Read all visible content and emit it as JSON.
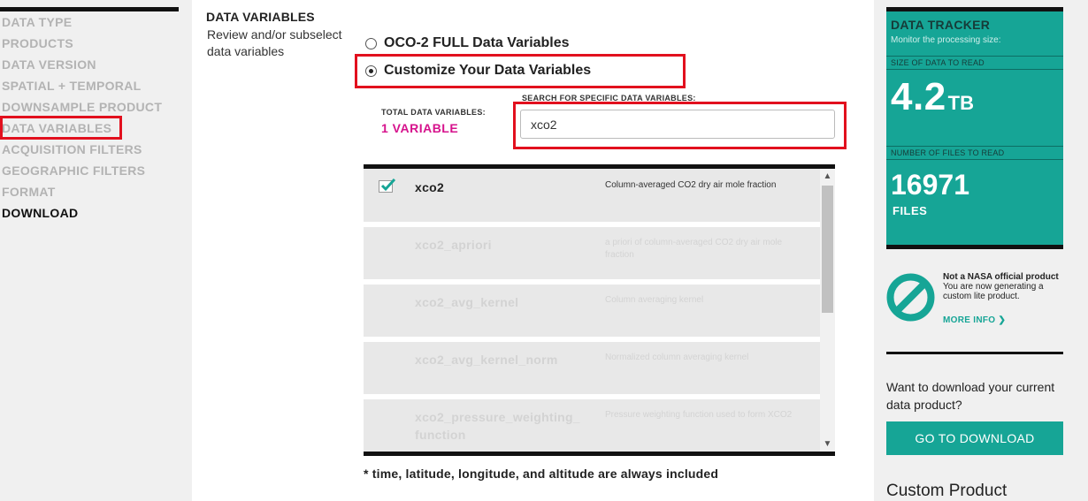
{
  "nav": {
    "items": [
      {
        "label": "DATA TYPE"
      },
      {
        "label": "PRODUCTS"
      },
      {
        "label": "DATA VERSION"
      },
      {
        "label": "SPATIAL + TEMPORAL"
      },
      {
        "label": "DOWNSAMPLE PRODUCT"
      },
      {
        "label": "DATA VARIABLES"
      },
      {
        "label": "ACQUISITION FILTERS"
      },
      {
        "label": "GEOGRAPHIC FILTERS"
      },
      {
        "label": "FORMAT"
      },
      {
        "label": "DOWNLOAD"
      }
    ]
  },
  "section": {
    "title": "DATA VARIABLES",
    "description": "Review and/or subselect data variables"
  },
  "options": {
    "full_label": "OCO-2 FULL Data Variables",
    "custom_label": "Customize Your Data Variables"
  },
  "totals": {
    "label": "TOTAL DATA VARIABLES:",
    "value": "1 VARIABLE"
  },
  "search": {
    "label": "SEARCH FOR SPECIFIC DATA VARIABLES:",
    "value": "xco2"
  },
  "variables": [
    {
      "name": "xco2",
      "description": "Column-averaged CO2 dry air mole fraction",
      "checked": true
    },
    {
      "name": "xco2_apriori",
      "description": "a priori of column-averaged CO2 dry air mole fraction"
    },
    {
      "name": "xco2_avg_kernel",
      "description": "Column averaging kernel"
    },
    {
      "name": "xco2_avg_kernel_norm",
      "description": "Normalized column averaging kernel"
    },
    {
      "name": "xco2_pressure_weighting_function",
      "description": "Pressure weighting function used to form XCO2"
    }
  ],
  "footnote": "* time, latitude, longitude, and altitude are always included",
  "tracker": {
    "title": "DATA TRACKER",
    "subtitle": "Monitor the processing size:",
    "size_label": "SIZE OF DATA TO READ",
    "size_value": "4.2",
    "size_unit": "TB",
    "files_label": "NUMBER OF FILES TO READ",
    "files_value": "16971",
    "files_unit": "FILES"
  },
  "notice": {
    "title": "Not a NASA official product",
    "body": "You are now generating a custom lite product.",
    "more": "MORE INFO"
  },
  "download": {
    "question": "Want to download your current data product?",
    "button": "GO TO DOWNLOAD"
  },
  "custom": {
    "title": "Custom Product"
  },
  "colors": {
    "accent": "#16a596",
    "magenta": "#d6128c",
    "highlight": "#e2101e"
  }
}
